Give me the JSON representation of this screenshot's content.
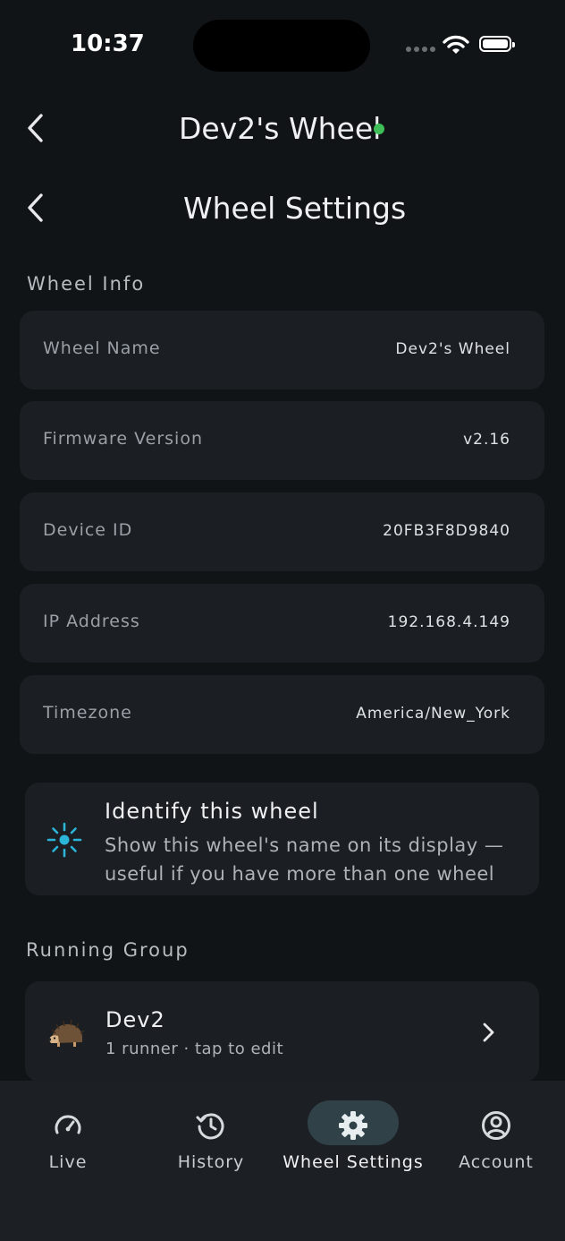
{
  "status_bar": {
    "time": "10:37"
  },
  "header": {
    "title": "Dev2's Wheel",
    "subtitle": "Wheel Settings"
  },
  "wheel_info": {
    "section_title": "Wheel Info",
    "rows": [
      {
        "label": "Wheel Name",
        "value": "Dev2's Wheel"
      },
      {
        "label": "Firmware Version",
        "value": "v2.16"
      },
      {
        "label": "Device ID",
        "value": "20FB3F8D9840"
      },
      {
        "label": "IP Address",
        "value": "192.168.4.149"
      },
      {
        "label": "Timezone",
        "value": "America/New_York"
      }
    ]
  },
  "identify": {
    "title": "Identify this wheel",
    "description": "Show this wheel's name on its display — useful if you have more than one wheel"
  },
  "running_group": {
    "section_title": "Running Group",
    "name": "Dev2",
    "subtitle": "1 runner · tap to edit",
    "avatar_icon": "hedgehog-icon"
  },
  "bottom_nav": {
    "items": [
      {
        "label": "Live",
        "icon": "speedometer-icon"
      },
      {
        "label": "History",
        "icon": "history-icon"
      },
      {
        "label": "Wheel Settings",
        "icon": "gear-icon",
        "active": true
      },
      {
        "label": "Account",
        "icon": "account-icon"
      }
    ]
  },
  "colors": {
    "background": "#101417",
    "card": "#1b1f23",
    "accent": "#2bb5d8",
    "online": "#3fbf5a"
  }
}
